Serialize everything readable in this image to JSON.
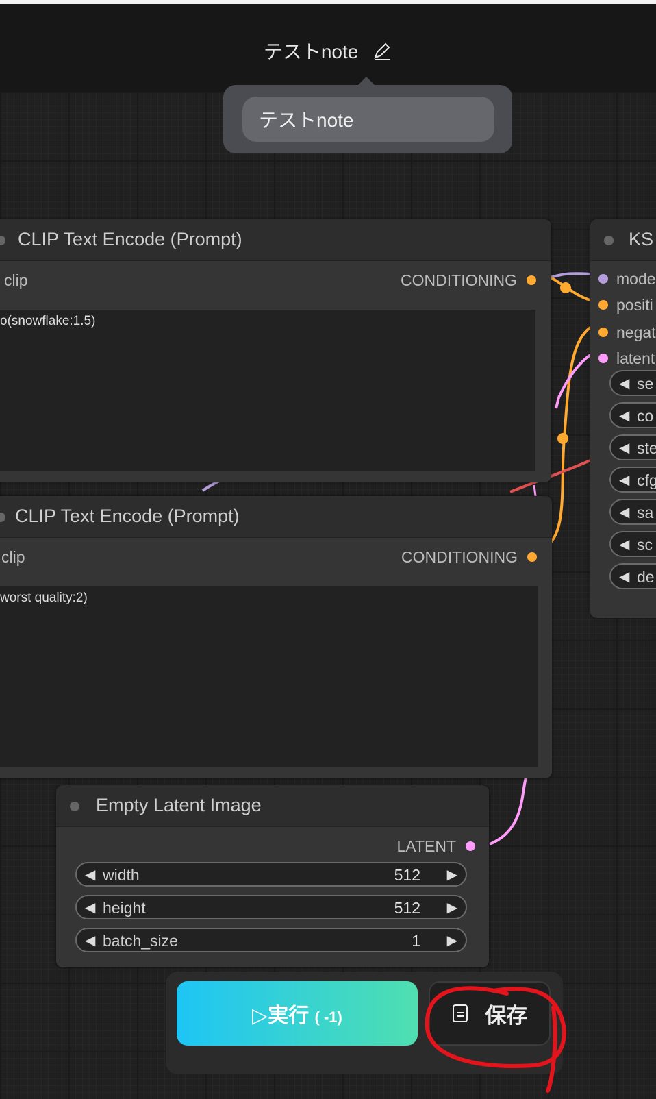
{
  "header": {
    "title": "テストnote"
  },
  "popover": {
    "input_value": "テストnote"
  },
  "clip_node_1": {
    "title": "CLIP Text Encode (Prompt)",
    "input": "clip",
    "output": "CONDITIONING",
    "text": "o(snowflake:1.5)"
  },
  "clip_node_2": {
    "title": "CLIP Text Encode (Prompt)",
    "input": "clip",
    "output": "CONDITIONING",
    "text": "worst quality:2)"
  },
  "ksampler": {
    "title": "KS",
    "inputs": [
      "mode",
      "positi",
      "negat",
      "latent"
    ],
    "widgets": [
      "se",
      "co",
      "ste",
      "cfg",
      "sa",
      "sc",
      "de"
    ]
  },
  "latent_node": {
    "title": "Empty Latent Image",
    "output": "LATENT",
    "widgets": [
      {
        "label": "width",
        "value": "512"
      },
      {
        "label": "height",
        "value": "512"
      },
      {
        "label": "batch_size",
        "value": "1"
      }
    ]
  },
  "toolbar": {
    "run_label": "▷実行",
    "run_badge": "( -1)",
    "save_label": "保存"
  },
  "colors": {
    "model": "#b39ddb",
    "conditioning": "#ffa931",
    "latent": "#ff9cf9",
    "annotation": "#e3141c"
  }
}
